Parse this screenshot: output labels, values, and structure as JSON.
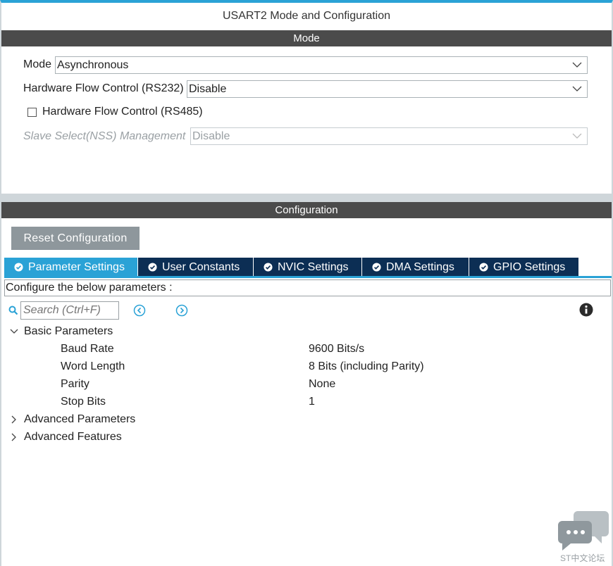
{
  "window": {
    "title": "USART2 Mode and Configuration"
  },
  "mode_section": {
    "header": "Mode",
    "mode_label": "Mode",
    "mode_value": "Asynchronous",
    "hw_flow_rs232_label": "Hardware Flow Control (RS232)",
    "hw_flow_rs232_value": "Disable",
    "hw_flow_rs485_label": "Hardware Flow Control (RS485)",
    "hw_flow_rs485_checked": false,
    "nss_label": "Slave Select(NSS) Management",
    "nss_value": "Disable"
  },
  "config_section": {
    "header": "Configuration",
    "reset_label": "Reset Configuration",
    "tabs": [
      {
        "label": "Parameter Settings",
        "active": true
      },
      {
        "label": "User Constants",
        "active": false
      },
      {
        "label": "NVIC Settings",
        "active": false
      },
      {
        "label": "DMA Settings",
        "active": false
      },
      {
        "label": "GPIO Settings",
        "active": false
      }
    ],
    "description": "Configure the below parameters :",
    "search_placeholder": "Search (Ctrl+F)"
  },
  "tree": {
    "basic": {
      "label": "Basic Parameters",
      "params": [
        {
          "name": "Baud Rate",
          "value": "9600 Bits/s"
        },
        {
          "name": "Word Length",
          "value": "8 Bits (including Parity)"
        },
        {
          "name": "Parity",
          "value": "None"
        },
        {
          "name": "Stop Bits",
          "value": "1"
        }
      ]
    },
    "advanced_params": "Advanced Parameters",
    "advanced_features": "Advanced Features"
  },
  "watermark": {
    "text": "ST中文论坛"
  },
  "colors": {
    "accent": "#2aa2d6",
    "tab_dark": "#0c2e54",
    "section_bar": "#4b4b4b",
    "button_gray": "#8e979c"
  },
  "icons": [
    "chevron-down-icon",
    "check-circle-icon",
    "search-icon",
    "arrow-left-circle-icon",
    "arrow-right-circle-icon",
    "info-icon",
    "expand-chevron-icon",
    "collapse-chevron-icon",
    "chat-bubble-icon"
  ]
}
